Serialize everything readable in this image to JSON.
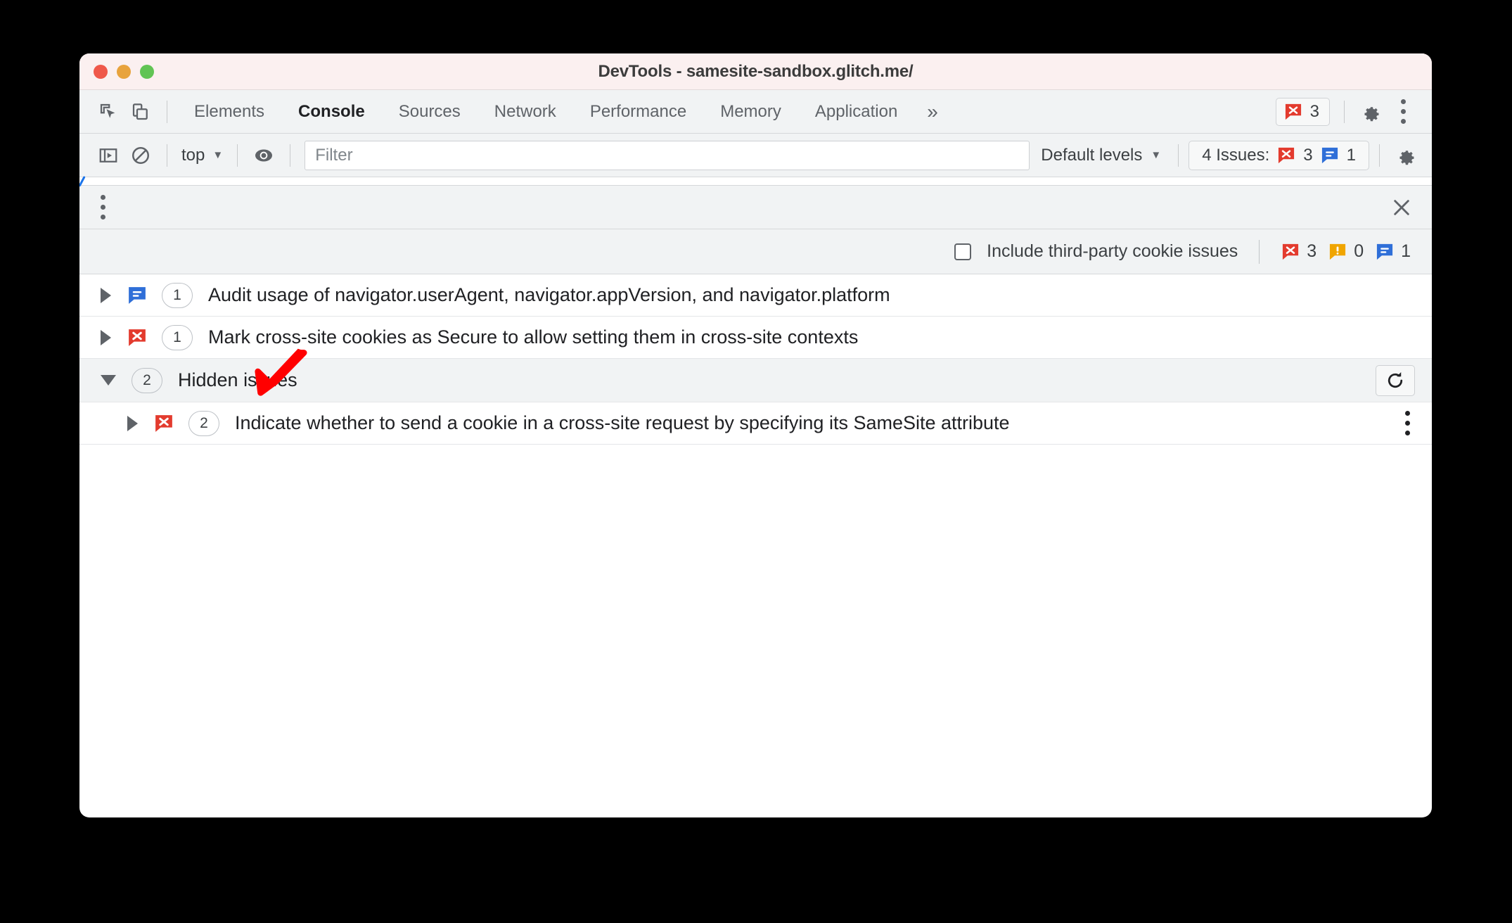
{
  "window": {
    "title": "DevTools - samesite-sandbox.glitch.me/",
    "traffic_lights": [
      "close-red",
      "minimize-yellow",
      "maximize-green"
    ]
  },
  "tabbar": {
    "inspect_icon": "inspect-element-icon",
    "device_icon": "device-toolbar-icon",
    "tabs": [
      {
        "label": "Elements",
        "active": false
      },
      {
        "label": "Console",
        "active": true
      },
      {
        "label": "Sources",
        "active": false
      },
      {
        "label": "Network",
        "active": false
      },
      {
        "label": "Performance",
        "active": false
      },
      {
        "label": "Memory",
        "active": false
      },
      {
        "label": "Application",
        "active": false
      }
    ],
    "overflow_label": "»",
    "error_badge": {
      "icon": "error-icon",
      "count": "3"
    },
    "settings_icon": "gear-icon",
    "more_icon": "kebab-menu-icon"
  },
  "console_toolbar": {
    "sidebar_toggle_icon": "console-sidebar-icon",
    "clear_console_icon": "clear-console-icon",
    "context_selector": {
      "value": "top",
      "caret": "▼"
    },
    "live_expression_icon": "eye-icon",
    "filter": {
      "placeholder": "Filter",
      "value": ""
    },
    "levels": {
      "label": "Default levels",
      "caret": "▼"
    },
    "issues_button": {
      "label": "4 Issues:",
      "error_count": "3",
      "info_count": "1"
    },
    "settings_icon": "gear-icon"
  },
  "drawer": {
    "more_icon": "kebab-menu-icon",
    "close_icon": "close-icon",
    "third_party": {
      "checkbox_checked": false,
      "label": "Include third-party cookie issues",
      "error_count": "3",
      "warning_count": "0",
      "info_count": "1"
    },
    "issues": [
      {
        "expanded": false,
        "triangle": "▶",
        "kind": "info",
        "icon": "info-issue-icon",
        "count": "1",
        "text": "Audit usage of navigator.userAgent, navigator.appVersion, and navigator.platform"
      },
      {
        "expanded": false,
        "triangle": "▶",
        "kind": "error",
        "icon": "error-issue-icon",
        "count": "1",
        "text": "Mark cross-site cookies as Secure to allow setting them in cross-site contexts"
      }
    ],
    "hidden_group": {
      "expanded": true,
      "triangle": "▼",
      "count": "2",
      "label": "Hidden issues",
      "refresh_icon": "refresh-icon",
      "children": [
        {
          "expanded": false,
          "triangle": "▶",
          "kind": "error",
          "icon": "error-issue-icon",
          "count": "2",
          "text": "Indicate whether to send a cookie in a cross-site request by specifying its SameSite attribute",
          "more_icon": "kebab-menu-icon"
        }
      ]
    }
  },
  "annotation": {
    "arrow_color": "#ff0000",
    "points_at": "hidden-issues-row"
  },
  "colors": {
    "titlebar_bg": "#fbf0f0",
    "toolbar_bg": "#f1f3f4",
    "error_red": "#e33b2e",
    "warning_orange": "#f0a500",
    "info_blue": "#1a73e8",
    "text_primary": "#202124",
    "text_secondary": "#5f6368"
  }
}
